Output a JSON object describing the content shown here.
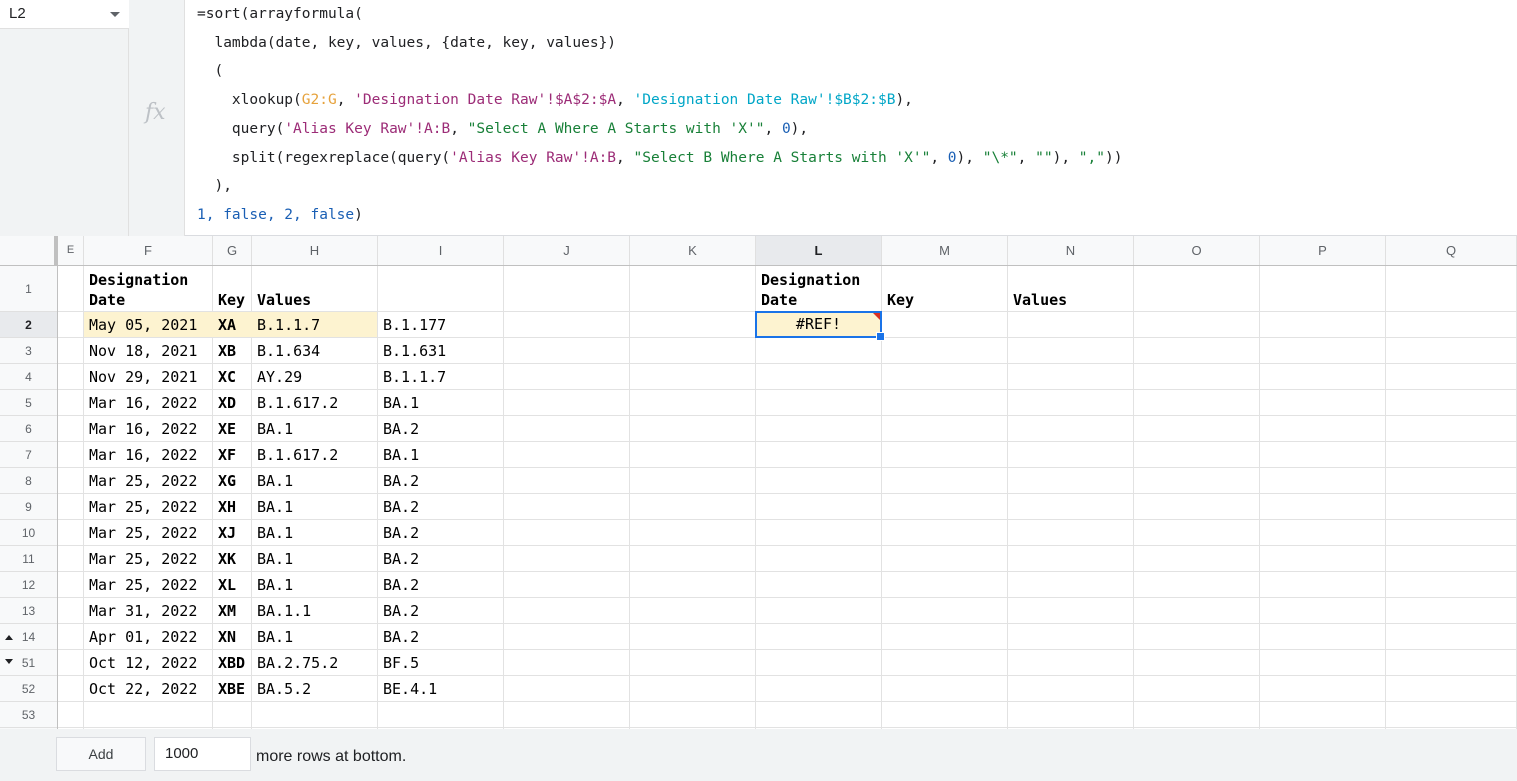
{
  "name_box": {
    "cell_ref": "L2"
  },
  "formula_bar": {
    "fx_label": "fx",
    "lines": [
      [
        {
          "t": "=sort(arrayformula("
        }
      ],
      [
        {
          "t": "  lambda(date, key, values, {date, key, values})"
        }
      ],
      [
        {
          "t": "  ("
        }
      ],
      [
        {
          "t": "    xlookup("
        },
        {
          "t": "G2:G",
          "c": "ref1"
        },
        {
          "t": ", "
        },
        {
          "t": "'Designation Date Raw'!$A$2:$A",
          "c": "str1"
        },
        {
          "t": ", "
        },
        {
          "t": "'Designation Date Raw'!$B$2:$B",
          "c": "str2"
        },
        {
          "t": "),"
        }
      ],
      [
        {
          "t": "    query("
        },
        {
          "t": "'Alias Key Raw'!A:B",
          "c": "str1"
        },
        {
          "t": ", "
        },
        {
          "t": "\"Select A Where A Starts with 'X'\"",
          "c": "str3"
        },
        {
          "t": ", "
        },
        {
          "t": "0",
          "c": "num"
        },
        {
          "t": "),"
        }
      ],
      [
        {
          "t": "    split(regexreplace(query("
        },
        {
          "t": "'Alias Key Raw'!A:B",
          "c": "str1"
        },
        {
          "t": ", "
        },
        {
          "t": "\"Select B Where A Starts with 'X'\"",
          "c": "str3"
        },
        {
          "t": ", "
        },
        {
          "t": "0",
          "c": "num"
        },
        {
          "t": "), "
        },
        {
          "t": "\"\\*\"",
          "c": "str3"
        },
        {
          "t": ", "
        },
        {
          "t": "\"\"",
          "c": "str3"
        },
        {
          "t": "), "
        },
        {
          "t": "\",\"",
          "c": "str3"
        },
        {
          "t": "))"
        }
      ],
      [
        {
          "t": "  ),"
        }
      ],
      [
        {
          "t": "1, false, 2, false",
          "c": "num"
        },
        {
          "t": ")"
        }
      ]
    ]
  },
  "columns": [
    "E",
    "F",
    "G",
    "H",
    "I",
    "J",
    "K",
    "L",
    "M",
    "N",
    "O",
    "P",
    "Q"
  ],
  "selected_column": "L",
  "rows": [
    "1",
    "2",
    "3",
    "4",
    "5",
    "6",
    "7",
    "8",
    "9",
    "10",
    "11",
    "12",
    "13",
    "14",
    "51",
    "52",
    "53"
  ],
  "header_row": {
    "F": "Designation\nDate",
    "G": "Key",
    "H": "Values",
    "L": "Designation\nDate",
    "M": "Key",
    "N": "Values"
  },
  "data_rows": [
    {
      "row": "2",
      "F": "May 05, 2021",
      "G": "XA",
      "H": "B.1.1.7",
      "I": "B.1.177"
    },
    {
      "row": "3",
      "F": "Nov 18, 2021",
      "G": "XB",
      "H": "B.1.634",
      "I": "B.1.631"
    },
    {
      "row": "4",
      "F": "Nov 29, 2021",
      "G": "XC",
      "H": "AY.29",
      "I": "B.1.1.7"
    },
    {
      "row": "5",
      "F": "Mar 16, 2022",
      "G": "XD",
      "H": "B.1.617.2",
      "I": "BA.1"
    },
    {
      "row": "6",
      "F": "Mar 16, 2022",
      "G": "XE",
      "H": "BA.1",
      "I": "BA.2"
    },
    {
      "row": "7",
      "F": "Mar 16, 2022",
      "G": "XF",
      "H": "B.1.617.2",
      "I": "BA.1"
    },
    {
      "row": "8",
      "F": "Mar 25, 2022",
      "G": "XG",
      "H": "BA.1",
      "I": "BA.2"
    },
    {
      "row": "9",
      "F": "Mar 25, 2022",
      "G": "XH",
      "H": "BA.1",
      "I": "BA.2"
    },
    {
      "row": "10",
      "F": "Mar 25, 2022",
      "G": "XJ",
      "H": "BA.1",
      "I": "BA.2"
    },
    {
      "row": "11",
      "F": "Mar 25, 2022",
      "G": "XK",
      "H": "BA.1",
      "I": "BA.2"
    },
    {
      "row": "12",
      "F": "Mar 25, 2022",
      "G": "XL",
      "H": "BA.1",
      "I": "BA.2"
    },
    {
      "row": "13",
      "F": "Mar 31, 2022",
      "G": "XM",
      "H": "BA.1.1",
      "I": "BA.2"
    },
    {
      "row": "14",
      "F": "Apr 01, 2022",
      "G": "XN",
      "H": "BA.1",
      "I": "BA.2"
    },
    {
      "row": "51",
      "F": "Oct 12, 2022",
      "G": "XBD",
      "H": "BA.2.75.2",
      "I": "BF.5"
    },
    {
      "row": "52",
      "F": "Oct 22, 2022",
      "G": "XBE",
      "H": "BA.5.2",
      "I": "BE.4.1"
    }
  ],
  "active_cell": {
    "ref": "L2",
    "value": "#REF!"
  },
  "bottom_bar": {
    "add_label": "Add",
    "rows_value": "1000",
    "suffix": "more rows at bottom."
  },
  "colors": {
    "highlight": "#fdf3d0",
    "selection": "#1a73e8",
    "error_marker": "#d93025"
  }
}
